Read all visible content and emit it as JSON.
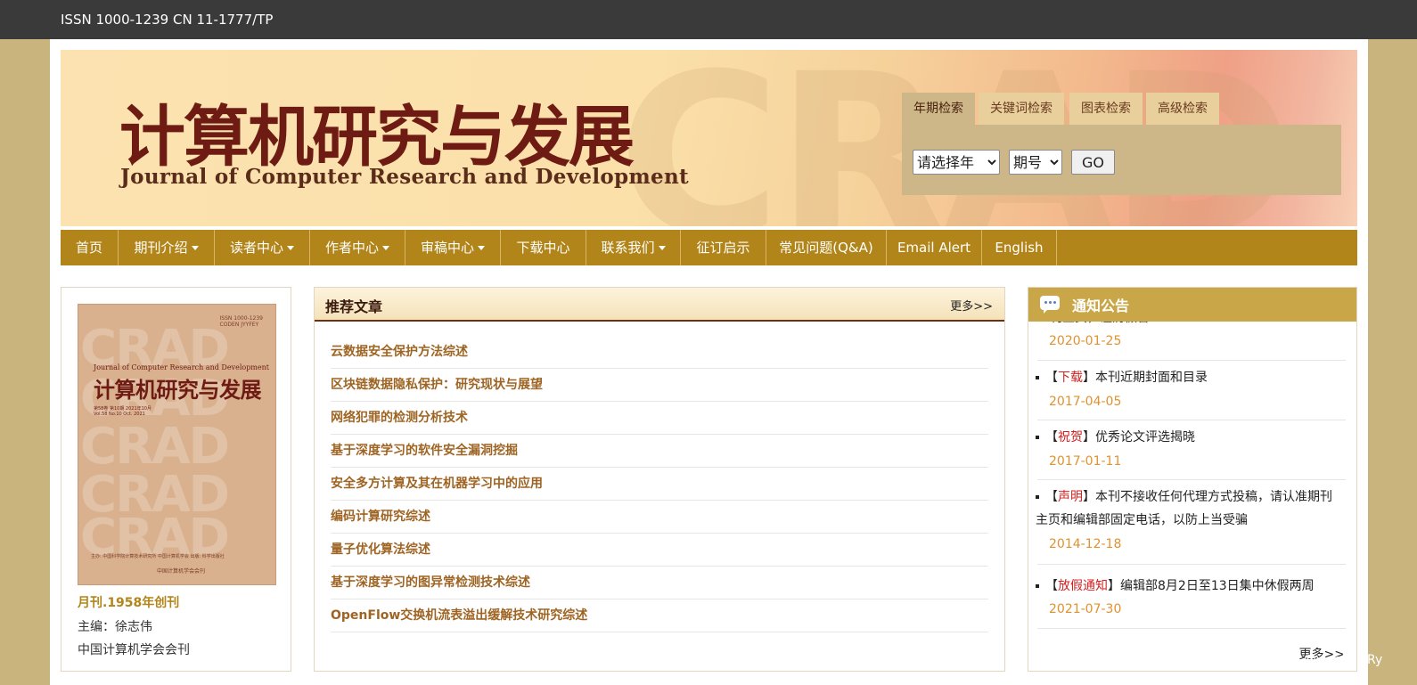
{
  "topbar": {
    "issn": "ISSN 1000-1239 CN 11-1777/TP"
  },
  "banner": {
    "watermark": "CRAD",
    "title_cn": "计算机研究与发展",
    "title_en": "Journal of Computer Research and Development"
  },
  "search": {
    "tabs": [
      "年期检索",
      "关键词检索",
      "图表检索",
      "高级检索"
    ],
    "year_select": "请选择年",
    "issue_select": "期号",
    "go_label": "GO"
  },
  "nav": {
    "items": [
      {
        "label": "首页"
      },
      {
        "label": "期刊介绍"
      },
      {
        "label": "读者中心"
      },
      {
        "label": "作者中心"
      },
      {
        "label": "审稿中心"
      },
      {
        "label": "下载中心"
      },
      {
        "label": "联系我们"
      },
      {
        "label": "征订启示"
      },
      {
        "label": "常见问题(Q&A)"
      },
      {
        "label": "Email Alert"
      },
      {
        "label": "English"
      }
    ]
  },
  "left": {
    "cover": {
      "crad": "CRAD",
      "issn_lines": [
        "ISSN 1000-1239",
        "CODEN JYYFEY"
      ],
      "title_en": "Journal of Computer Research and Development",
      "title_cn": "计算机研究与发展",
      "vol_lines": [
        "第58卷 第10期 2021年10月",
        "Vol.58 No.10 Oct. 2021"
      ],
      "footer": "主办: 中国科学院计算技术研究所 中国计算机学会 出版: 科学出版社",
      "publisher": "中国计算机学会会刊"
    },
    "founded": "月刊.1958年创刊",
    "editor": "主编：徐志伟",
    "society": "中国计算机学会会刊"
  },
  "recommended": {
    "title": "推荐文章",
    "more": "更多>>",
    "articles": [
      "云数据安全保护方法综述",
      "区块链数据隐私保护：研究现状与展望",
      "网络犯罪的检测分析技术",
      "基于深度学习的软件安全漏洞挖掘",
      "安全多方计算及其在机器学习中的应用",
      "编码计算研究综述",
      "量子优化算法综述",
      "基于深度学习的图异常检测技术综述",
      "OpenFlow交换机流表溢出缓解技术研究综述"
    ]
  },
  "notices": {
    "title": "通知公告",
    "partial_text": "刊主页，谨防假冒",
    "partial_date": "2020-01-25",
    "items": [
      {
        "tag": "下载",
        "text": "本刊近期封面和目录",
        "date": "2017-04-05"
      },
      {
        "tag": "祝贺",
        "text": "优秀论文评选揭晓",
        "date": "2017-01-11"
      },
      {
        "tag": "声明",
        "text": "本刊不接收任何代理方式投稿，请认准期刊主页和编辑部固定电话，以防上当受骗",
        "date": "2014-12-18"
      },
      {
        "tag": "放假通知",
        "text": "编辑部8月2日至13日集中休假两周",
        "date": "2021-07-30"
      }
    ],
    "more": "更多>>"
  },
  "watermark": "CSDN @xiaobai_Ry"
}
